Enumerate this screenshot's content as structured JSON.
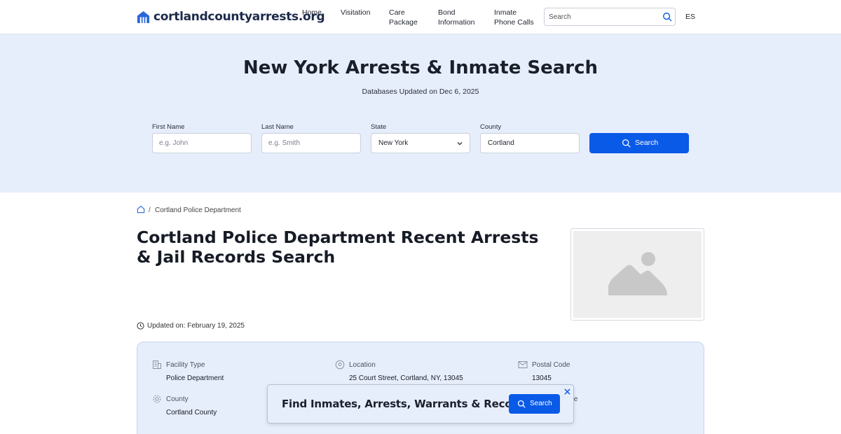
{
  "header": {
    "logo_text": "cortlandcountyarrests.org",
    "nav": [
      {
        "label": "Home"
      },
      {
        "label": "Visitation"
      },
      {
        "label": "Care\nPackage"
      },
      {
        "label": "Bond\nInformation"
      },
      {
        "label": "Inmate\nPhone Calls"
      }
    ],
    "search_placeholder": "Search",
    "lang": "ES"
  },
  "hero": {
    "title": "New York Arrests & Inmate Search",
    "subtitle": "Databases Updated on Dec 6, 2025",
    "form": {
      "first_name_label": "First Name",
      "first_name_placeholder": "e.g. John",
      "last_name_label": "Last Name",
      "last_name_placeholder": "e.g. Smith",
      "state_label": "State",
      "state_value": "New York",
      "county_label": "County",
      "county_value": "Cortland",
      "search_label": "Search"
    }
  },
  "breadcrumb": {
    "current": "Cortland Police Department",
    "separator": "/"
  },
  "page": {
    "title": "Cortland Police Department Recent Arrests & Jail Records Search",
    "updated": "Updated on: February 19, 2025"
  },
  "info": {
    "facility_type_label": "Facility Type",
    "facility_type_value": "Police Department",
    "location_label": "Location",
    "location_value": "25 Court Street, Cortland, NY, 13045",
    "postal_code_label": "Postal Code",
    "postal_code_value": "13045",
    "county_label": "County",
    "county_value": "Cortland County",
    "partial_label": "te"
  },
  "popup": {
    "text": "Find Inmates, Arrests, Warrants & Records",
    "button": "Search"
  },
  "colors": {
    "accent": "#0a5ae8",
    "hero_bg": "#e7eefb"
  }
}
